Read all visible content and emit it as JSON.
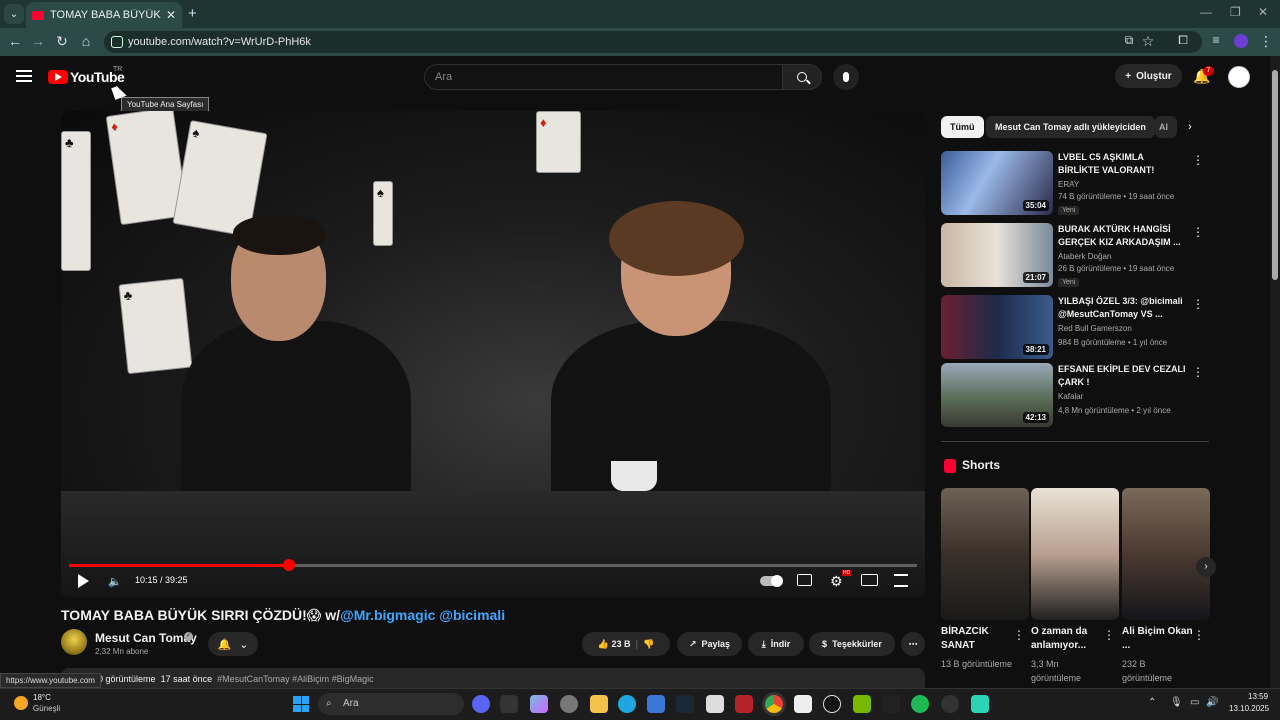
{
  "browser": {
    "tab_title": "TOMAY BABA BÜYÜK SIRRI ÇÖZDÜ",
    "url": "youtube.com/watch?v=WrUrD-PhH6k"
  },
  "youtube": {
    "logo_text": "YouTube",
    "region": "TR",
    "tooltip": "YouTube Ana Sayfası",
    "search_placeholder": "Ara",
    "create_label": "Oluştur",
    "notification_count": "7"
  },
  "player": {
    "time": "10:15 / 39:25",
    "progress_fraction": 0.26
  },
  "video": {
    "title_text": "TOMAY BABA BÜYÜK SIRRI ÇÖZDÜ!😱 w/",
    "mention1": "@Mr.bigmagic",
    "mention2": "@bicimali",
    "channel": "Mesut Can Tomay",
    "subscribers": "2,32 Mn abone",
    "likes": "23 B",
    "share": "Paylaş",
    "download": "İndir",
    "thanks": "Teşekkürler",
    "views": "0 görüntüleme",
    "age": "17 saat önce",
    "tags": "#MesutCanTomay #AliBiçim #BigMagic"
  },
  "status_url": "https://www.youtube.com",
  "sidebar": {
    "chips": [
      "Tümü",
      "Mesut Can Tomay adlı yükleyiciden",
      "Al"
    ],
    "recommendations": [
      {
        "title": "LVBEL C5 AŞKIMLA BİRLİKTE VALORANT! @LVBELC5",
        "channel": "ERAY",
        "meta": "74 B görüntüleme • 19 saat önce",
        "badge": "Yeni",
        "duration": "35:04"
      },
      {
        "title": "BURAK AKTÜRK HANGİSİ GERÇEK KIZ ARKADAŞIM ...",
        "channel": "Ataberk Doğan",
        "meta": "26 B görüntüleme • 19 saat önce",
        "badge": "Yeni",
        "duration": "21:07"
      },
      {
        "title": "YILBAŞI ÖZEL 3/3: @bicimali @MesutCanTomay VS ...",
        "channel": "Red Bull Gamerszon",
        "meta": "984 B görüntüleme • 1 yıl önce",
        "badge": "",
        "duration": "38:21"
      },
      {
        "title": "EFSANE EKİPLE DEV CEZALI ÇARK !",
        "channel": "Kafalar",
        "meta": "4,8 Mn görüntüleme • 2 yıl önce",
        "badge": "",
        "duration": "42:13"
      }
    ],
    "shorts_heading": "Shorts",
    "shorts": [
      {
        "title": "BİRAZCIK SANAT",
        "views": "13 B görüntüleme"
      },
      {
        "title": "O zaman da anlamıyor...",
        "views": "3,3 Mn görüntüleme"
      },
      {
        "title": "Ali Biçim Okan ...",
        "views": "232 B görüntüleme"
      }
    ]
  },
  "taskbar": {
    "temp": "18°C",
    "weather": "Güneşli",
    "search": "Ara",
    "time": "13:59",
    "date": "13.10.2025"
  },
  "colors": {
    "accent": "#ff0000",
    "link": "#3ea6ff",
    "browser_frame": "#2c4a47"
  }
}
